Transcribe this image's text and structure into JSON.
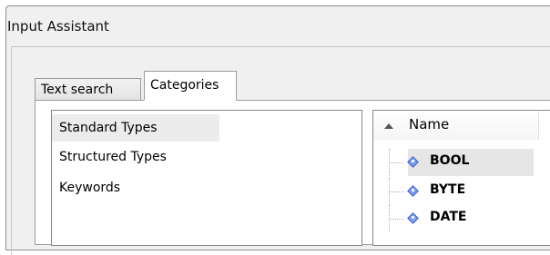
{
  "window": {
    "title": "Input Assistant"
  },
  "tabs": [
    {
      "label": "Text search"
    },
    {
      "label": "Categories"
    }
  ],
  "categories": {
    "selected": "Standard Types",
    "items": [
      {
        "label": "Standard Types"
      },
      {
        "label": "Structured Types"
      },
      {
        "label": "Keywords"
      }
    ]
  },
  "tree": {
    "column_header": "Name",
    "rows": [
      {
        "label": "BOOL",
        "icon": "blue-diamond-icon"
      },
      {
        "label": "BYTE",
        "icon": "blue-diamond-icon"
      },
      {
        "label": "DATE",
        "icon": "blue-diamond-icon"
      }
    ]
  }
}
